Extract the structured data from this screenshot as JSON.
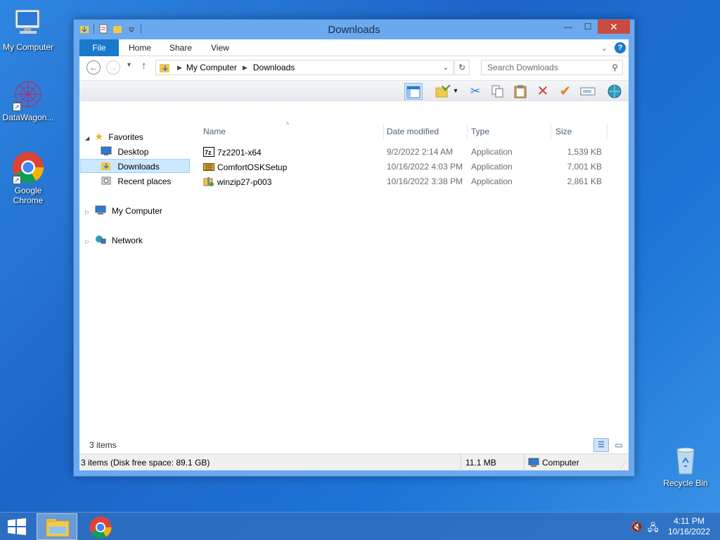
{
  "desktop": {
    "icons": [
      {
        "label": "My Computer"
      },
      {
        "label": "DataWagon..."
      },
      {
        "label": "Google Chrome"
      },
      {
        "label": "Recycle Bin"
      }
    ]
  },
  "window": {
    "title": "Downloads",
    "close_glyph": "✕",
    "min_glyph": "—",
    "max_glyph": "☐"
  },
  "ribbon": {
    "tabs": [
      "File",
      "Home",
      "Share",
      "View"
    ],
    "help_glyph": "?"
  },
  "address": {
    "crumbs": [
      "My Computer",
      "Downloads"
    ],
    "search_placeholder": "Search Downloads"
  },
  "nav": {
    "favorites": "Favorites",
    "desktop": "Desktop",
    "downloads": "Downloads",
    "recent": "Recent places",
    "computer": "My Computer",
    "network": "Network"
  },
  "columns": [
    "Name",
    "Date modified",
    "Type",
    "Size"
  ],
  "files": [
    {
      "name": "7z2201-x64",
      "date": "9/2/2022 2:14 AM",
      "type": "Application",
      "size": "1,539 KB",
      "icon": "7zip-icon"
    },
    {
      "name": "ComfortOSKSetup",
      "date": "10/16/2022 4:03 PM",
      "type": "Application",
      "size": "7,001 KB",
      "icon": "keyboard-app-icon"
    },
    {
      "name": "winzip27-p003",
      "date": "10/16/2022 3:38 PM",
      "type": "Application",
      "size": "2,861 KB",
      "icon": "winzip-icon"
    }
  ],
  "status": {
    "count": "3 items",
    "detail": "3 items (Disk free space: 89.1 GB)",
    "size": "11.1 MB",
    "location": "Computer"
  },
  "tray": {
    "time": "4:11 PM",
    "date": "10/16/2022"
  },
  "colors": {
    "accent": "#1979ca",
    "close": "#c94c3e",
    "selection": "#cce8ff"
  }
}
